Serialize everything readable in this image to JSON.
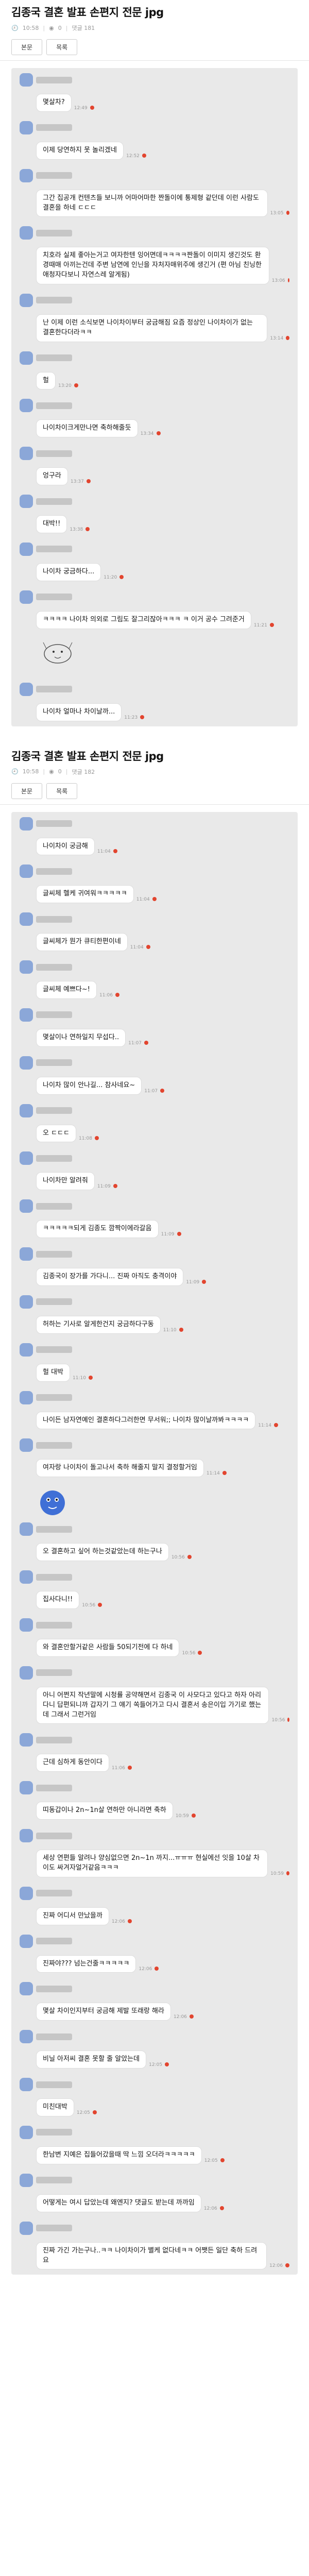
{
  "post1": {
    "title": "김종국 결혼 발표 손편지 전문 jpg",
    "meta": {
      "time": "10:58",
      "views_label": "0",
      "comments_label": "댓글 181"
    },
    "nav": {
      "prev": "본문",
      "list": "목록"
    }
  },
  "post2": {
    "title": "김종국 결혼 발표 손편지 전문 jpg",
    "meta": {
      "time": "10:58",
      "views_label": "0",
      "comments_label": "댓글 182"
    },
    "nav": {
      "prev": "본문",
      "list": "목록"
    }
  },
  "capture1": [
    {
      "time": "12:49",
      "text": "몇살차?"
    },
    {
      "time": "12:52",
      "text": "이제 당연하지 못 놀리겠네"
    },
    {
      "time": "13:05",
      "text": "그간 집공개 컨텐츠들 보니까 어마어마한 짠돌이에 통제형 같던데 이런 사람도 결혼을 하네 ㄷㄷㄷ"
    },
    {
      "time": "13:06",
      "text": "치호라 실제 좋아는거고 여자한텐 잉어면데ㅋㅋㅋㅋ짠돌이 이미지 생긴것도 환경때매 아끼는건데 주변 남연에 인닌을 자처자매위주에 생긴거 (편 아님 친닝한 애청자다보니 자연스레 알게됨)"
    },
    {
      "time": "13:14",
      "text": "난 이제 이런 소식보면 나이차이부터 궁금해짐 요즘 정상인 나이차이가 없는 결혼한다더라ㅋㅋ"
    },
    {
      "time": "13:20",
      "text": "헐"
    },
    {
      "time": "13:34",
      "text": "나이차이크게만나면 축하해줄듯"
    },
    {
      "time": "13:37",
      "text": "엉구라"
    },
    {
      "time": "13:38",
      "text": "대박!!"
    },
    {
      "time": "11:20",
      "text": "나이차 궁금하다..."
    },
    {
      "time": "11:21",
      "text": "ㅋㅋㅋㅋ 나이차 의외로 그림도 잘그리잖아ㅋㅋㅋ ㅋ 이거 공수 그려준거"
    },
    {
      "time": "11:23",
      "text": "나이차 얼마나 차이날까..."
    }
  ],
  "capture2": [
    {
      "time": "11:04",
      "text": "나이차이 궁금해"
    },
    {
      "time": "11:04",
      "text": "글씨체 헬케 귀여워ㅋㅋㅋㅋㅋ"
    },
    {
      "time": "11:04",
      "text": "글씨체가 뭔가 큐티한편이네"
    },
    {
      "time": "11:06",
      "text": "글씨체 예쁘다~!"
    },
    {
      "time": "11:07",
      "text": "몇살이나 연하일지 무섭다.."
    },
    {
      "time": "11:07",
      "text": "나이차 많이 안나길... 참사네요~"
    },
    {
      "time": "11:08",
      "text": "오 ㄷㄷㄷ"
    },
    {
      "time": "11:09",
      "text": "나이차만 알려줘"
    },
    {
      "time": "11:09",
      "text": "ㅋㅋㅋㅋㅋ되게 김종도 깜짝이에라갈음"
    },
    {
      "time": "11:09",
      "text": "김종국이 장가를 가다니... 진짜 아직도 충격이야"
    },
    {
      "time": "11:10",
      "text": "허하는 기사로 알게한건지 궁금하다구동"
    },
    {
      "time": "11:10",
      "text": "헐 대박"
    },
    {
      "time": "11:14",
      "text": "나이든 남자연예인 결혼하다그러한면 무서워;; 나이차 많이날까봐ㅋㅋㅋㅋ"
    },
    {
      "time": "11:14",
      "text": "여자랑 나이차이 돌고나서 축하 해줄지 말지 결정할거임"
    },
    {
      "time": "10:56",
      "text": "오 결혼하고 싶어 하는것같았는데 하는구나"
    },
    {
      "time": "10:56",
      "text": "집사다니!!"
    },
    {
      "time": "10:56",
      "text": "와 결혼안할거같은 사람들 50되기전에 다 하네"
    },
    {
      "time": "10:56",
      "text": "아니 어쩐지 작년말에 시청률 공약해면서 김종국 이 사모다고 있다고 하자 아리다니 답편되니까 갑자기 그 얘기 쏙들어가고 다시 결혼서 송은이입 가기로 했는데 그래서 그런거임"
    },
    {
      "time": "11:06",
      "text": "근데 심하게 동안이다"
    },
    {
      "time": "10:59",
      "text": "띠동갑이나 2n~1n살 연하만 아니라면 축하"
    },
    {
      "time": "10:59",
      "text": "세상 연편들 알려나 양심없으면 2n~1n 까지...ㅠㅠㅠ 현실에선 잇을 10살 차이도 싸겨자얼거같음ㅋㅋㅋ"
    },
    {
      "time": "12:06",
      "text": "진짜 어디서 만났을까"
    },
    {
      "time": "12:06",
      "text": "진짜야??? 넘는건줄ㅋㅋㅋㅋㅋ"
    },
    {
      "time": "12:06",
      "text": "몇살 차이인지부터 궁금해 제발 또래랑 해라"
    },
    {
      "time": "12:05",
      "text": "비닐 아저씨 결혼 못할 줄 알았는데"
    },
    {
      "time": "12:05",
      "text": "미친대박"
    },
    {
      "time": "12:05",
      "text": "한남변 지예은 집들어갔을때 딱 느낌 오더라ㅋㅋㅋㅋㅋ"
    },
    {
      "time": "12:06",
      "text": "어떻게는 여시 답았는데 왜엔지? 댓글도 받는데 까까임"
    },
    {
      "time": "12:06",
      "text": "진짜 가긴 가는구나..ㅋㅋ 나이차이가 별케 없다네ㅋㅋ 어쨋든 일단 축하 드려요"
    }
  ],
  "sticker_caption": "",
  "colors": {
    "accent": "#e2452f",
    "bubble": "#ffffff",
    "capture_bg": "#e9e9e9",
    "avatar": "#8ba7d8"
  }
}
